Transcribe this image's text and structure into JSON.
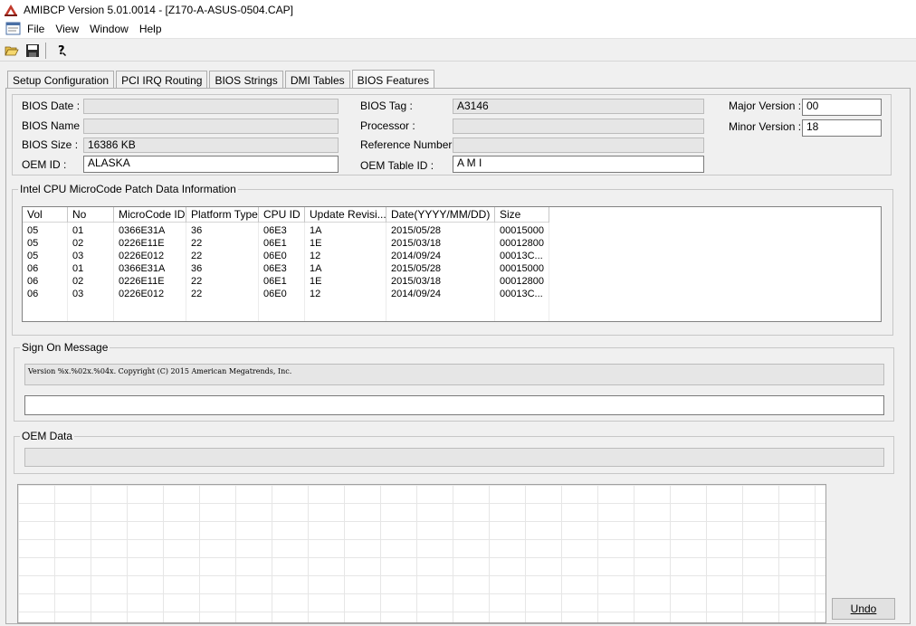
{
  "window": {
    "title": "AMIBCP Version 5.01.0014 - [Z170-A-ASUS-0504.CAP]"
  },
  "menu": [
    "File",
    "View",
    "Window",
    "Help"
  ],
  "toolbar": {
    "icons": [
      "open-folder-icon",
      "save-icon",
      "help-icon"
    ]
  },
  "tabs": [
    "Setup Configuration",
    "PCI IRQ Routing",
    "BIOS Strings",
    "DMI Tables",
    "BIOS Features"
  ],
  "active_tab": "BIOS Features",
  "bios_info": {
    "bios_date_label": "BIOS Date :",
    "bios_date": "",
    "bios_name_label": "BIOS Name :",
    "bios_name": "",
    "bios_size_label": "BIOS Size :",
    "bios_size": "16386 KB",
    "oem_id_label": "OEM ID :",
    "oem_id": "ALASKA",
    "bios_tag_label": "BIOS Tag :",
    "bios_tag": "A3146",
    "processor_label": "Processor :",
    "processor": "",
    "reference_number_label": "Reference Number :",
    "reference_number": "",
    "oem_table_id_label": "OEM Table ID :",
    "oem_table_id": "A M I",
    "major_version_label": "Major Version :",
    "major_version": "00",
    "minor_version_label": "Minor Version :",
    "minor_version": "18"
  },
  "microcode": {
    "legend": "Intel CPU MicroCode Patch Data Information",
    "columns": [
      "Vol",
      "No",
      "MicroCode ID",
      "Platform Type",
      "CPU ID",
      "Update Revisi...",
      "Date(YYYY/MM/DD)",
      "Size"
    ],
    "rows": [
      [
        "05",
        "01",
        "0366E31A",
        "36",
        "06E3",
        "1A",
        "2015/05/28",
        "00015000"
      ],
      [
        "05",
        "02",
        "0226E11E",
        "22",
        "06E1",
        "1E",
        "2015/03/18",
        "00012800"
      ],
      [
        "05",
        "03",
        "0226E012",
        "22",
        "06E0",
        "12",
        "2014/09/24",
        "00013C..."
      ],
      [
        "06",
        "01",
        "0366E31A",
        "36",
        "06E3",
        "1A",
        "2015/05/28",
        "00015000"
      ],
      [
        "06",
        "02",
        "0226E11E",
        "22",
        "06E1",
        "1E",
        "2015/03/18",
        "00012800"
      ],
      [
        "06",
        "03",
        "0226E012",
        "22",
        "06E0",
        "12",
        "2014/09/24",
        "00013C..."
      ]
    ]
  },
  "sign_on": {
    "legend": "Sign On Message",
    "message": "Version %x.%02x.%04x. Copyright (C) 2015 American Megatrends, Inc.",
    "second_line": ""
  },
  "oem_data": {
    "legend": "OEM Data",
    "value": ""
  },
  "buttons": {
    "undo": "Undo"
  }
}
